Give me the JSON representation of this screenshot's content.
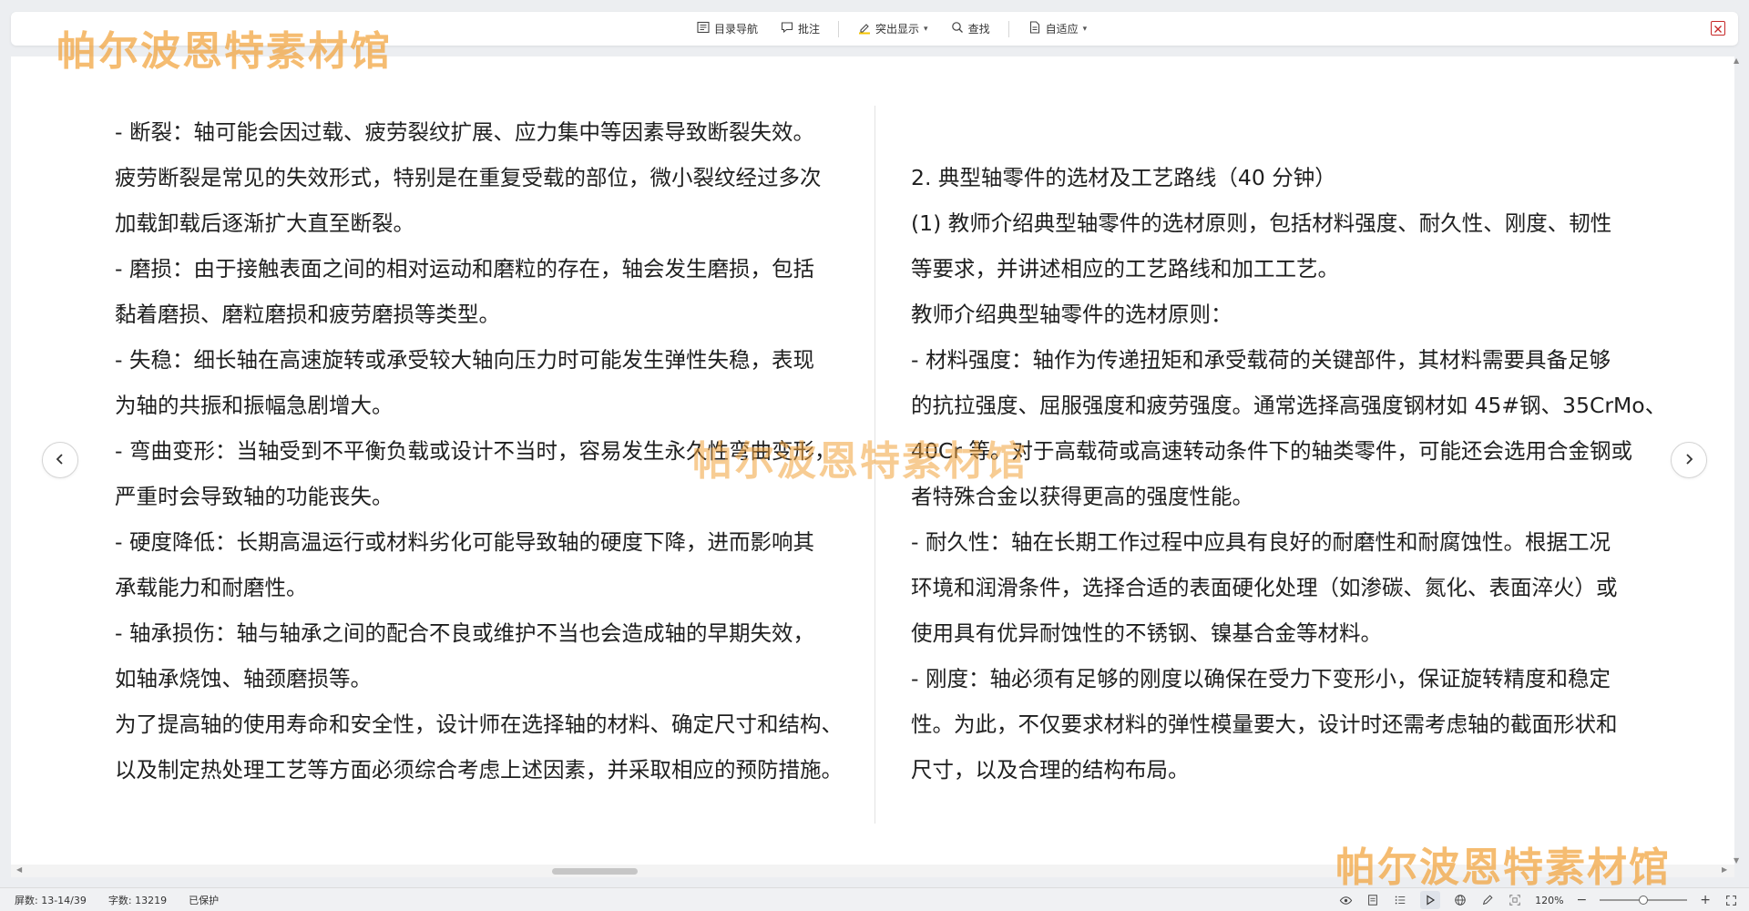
{
  "toolbar": {
    "buttons": [
      {
        "label": "目录导航",
        "icon": "toc-icon"
      },
      {
        "label": "批注",
        "icon": "comment-icon"
      },
      {
        "label": "突出显示",
        "icon": "highlight-icon"
      },
      {
        "label": "查找",
        "icon": "search-icon"
      },
      {
        "label": "自适应",
        "icon": "fit-page-icon"
      }
    ]
  },
  "watermark": {
    "text": "帕尔波恩特素材馆",
    "color": "#f2a33b"
  },
  "document": {
    "left_page_lines": [
      "- 断裂：轴可能会因过载、疲劳裂纹扩展、应力集中等因素导致断裂失效。",
      "疲劳断裂是常见的失效形式，特别是在重复受载的部位，微小裂纹经过多次",
      "加载卸载后逐渐扩大直至断裂。",
      "- 磨损：由于接触表面之间的相对运动和磨粒的存在，轴会发生磨损，包括",
      "黏着磨损、磨粒磨损和疲劳磨损等类型。",
      "- 失稳：细长轴在高速旋转或承受较大轴向压力时可能发生弹性失稳，表现",
      "为轴的共振和振幅急剧增大。",
      "- 弯曲变形：当轴受到不平衡负载或设计不当时，容易发生永久性弯曲变形，",
      "严重时会导致轴的功能丧失。",
      "- 硬度降低：长期高温运行或材料劣化可能导致轴的硬度下降，进而影响其",
      "承载能力和耐磨性。",
      "- 轴承损伤：轴与轴承之间的配合不良或维护不当也会造成轴的早期失效，",
      "如轴承烧蚀、轴颈磨损等。",
      "为了提高轴的使用寿命和安全性，设计师在选择轴的材料、确定尺寸和结构、",
      "以及制定热处理工艺等方面必须综合考虑上述因素，并采取相应的预防措施。"
    ],
    "right_page_lines": [
      "2. 典型轴零件的选材及工艺路线（40 分钟）",
      "(1) 教师介绍典型轴零件的选材原则，包括材料强度、耐久性、刚度、韧性",
      "等要求，并讲述相应的工艺路线和加工工艺。",
      "教师介绍典型轴零件的选材原则：",
      "- 材料强度：轴作为传递扭矩和承受载荷的关键部件，其材料需要具备足够",
      "的抗拉强度、屈服强度和疲劳强度。通常选择高强度钢材如 45#钢、35CrMo、",
      "40Cr 等。对于高载荷或高速转动条件下的轴类零件，可能还会选用合金钢或",
      "者特殊合金以获得更高的强度性能。",
      "- 耐久性：轴在长期工作过程中应具有良好的耐磨性和耐腐蚀性。根据工况",
      "环境和润滑条件，选择合适的表面硬化处理（如渗碳、氮化、表面淬火）或",
      "使用具有优异耐蚀性的不锈钢、镍基合金等材料。",
      "- 刚度：轴必须有足够的刚度以确保在受力下变形小，保证旋转精度和稳定",
      "性。为此，不仅要求材料的弹性模量要大，设计时还需考虑轴的截面形状和",
      "尺寸，以及合理的结构布局。"
    ]
  },
  "statusbar": {
    "page_info": "屏数: 13-14/39",
    "word_count": "字数: 13219",
    "protection": "已保护",
    "zoom": "120%",
    "zoom_fraction": 0.5
  }
}
